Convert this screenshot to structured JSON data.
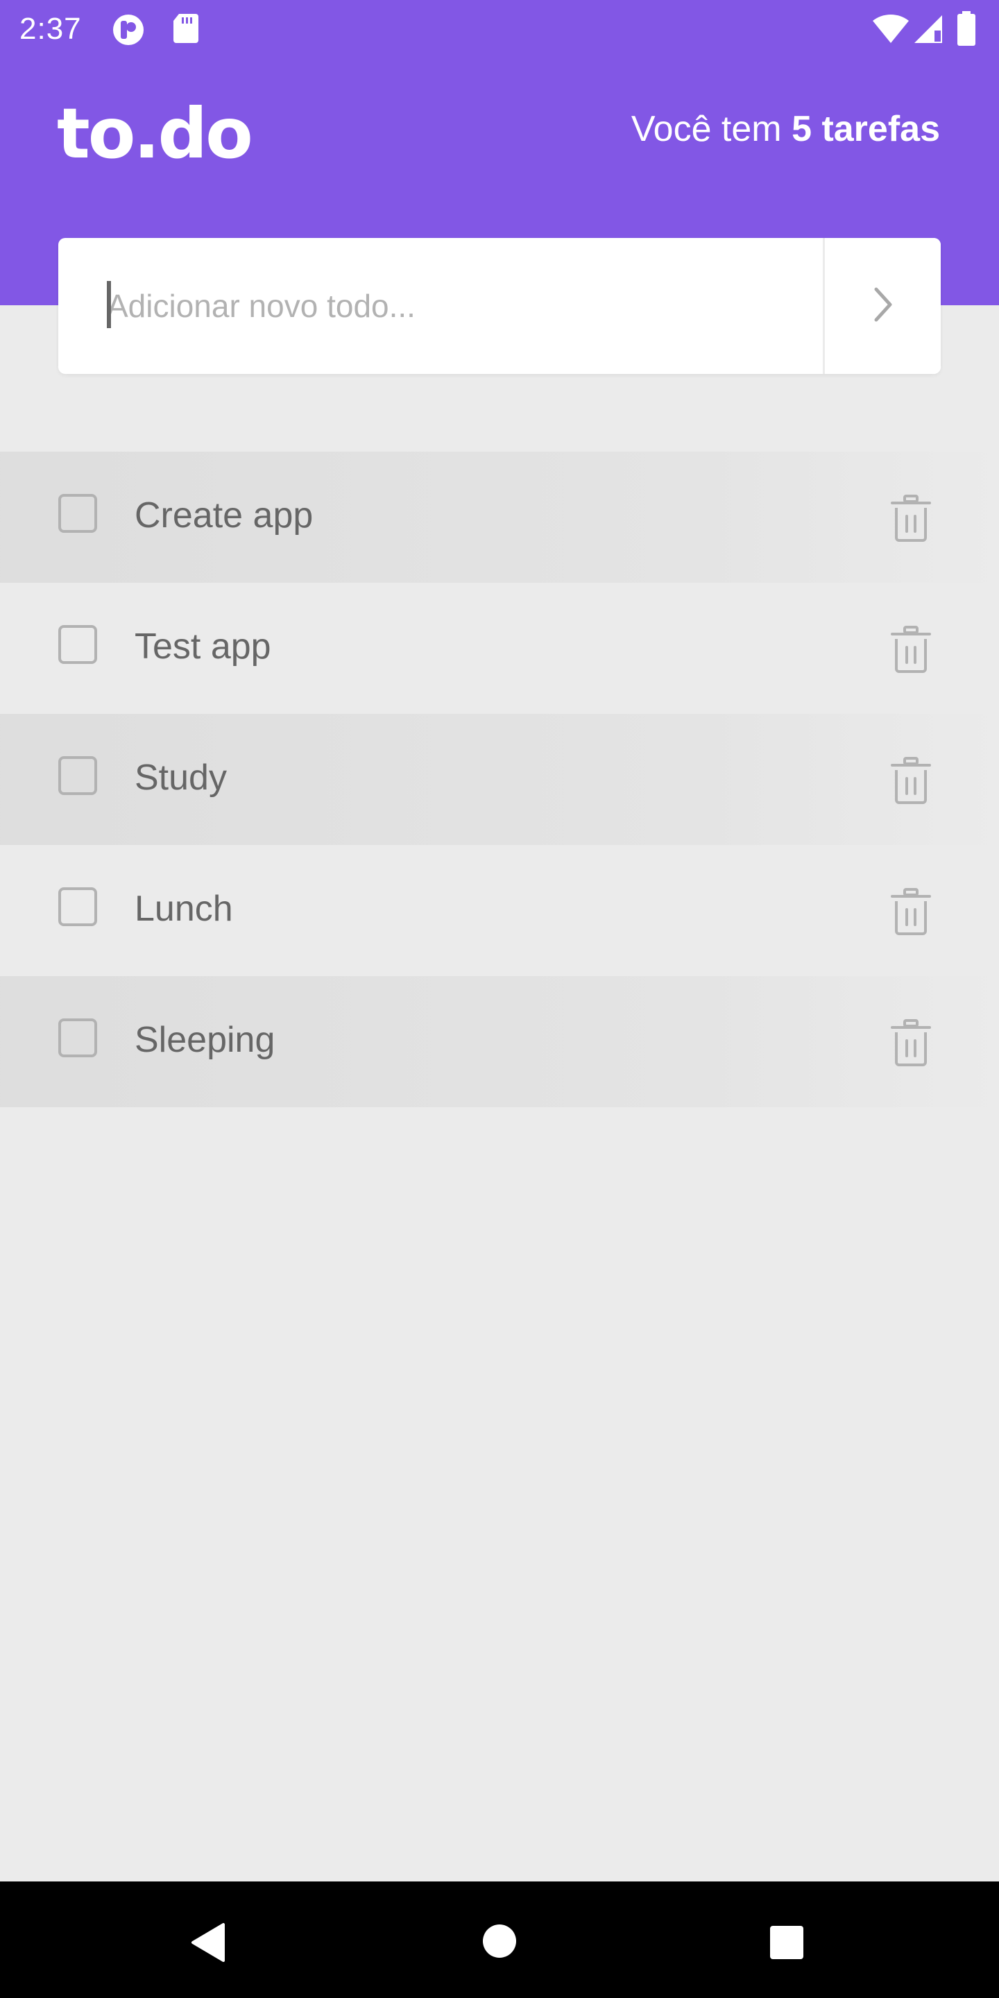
{
  "status_bar": {
    "time": "2:37",
    "left_icons": [
      "notification-app-icon",
      "sd-card-icon"
    ],
    "right_icons": [
      "wifi-icon",
      "cellular-signal-icon",
      "battery-icon"
    ]
  },
  "header": {
    "logo": "to.do",
    "counter_prefix": "Você tem",
    "counter_bold": "5 tarefas"
  },
  "input": {
    "placeholder": "Adicionar novo todo...",
    "value": "",
    "submit_icon": "chevron-right-icon"
  },
  "tasks": [
    {
      "label": "Create app",
      "done": false
    },
    {
      "label": "Test app",
      "done": false
    },
    {
      "label": "Study",
      "done": false
    },
    {
      "label": "Lunch",
      "done": false
    },
    {
      "label": "Sleeping",
      "done": false
    }
  ],
  "colors": {
    "accent": "#8257E5",
    "background": "#EBEBEB",
    "text": "#666666",
    "muted": "#B2B2B2"
  },
  "nav": {
    "icons": [
      "back-icon",
      "home-icon",
      "recents-icon"
    ]
  }
}
